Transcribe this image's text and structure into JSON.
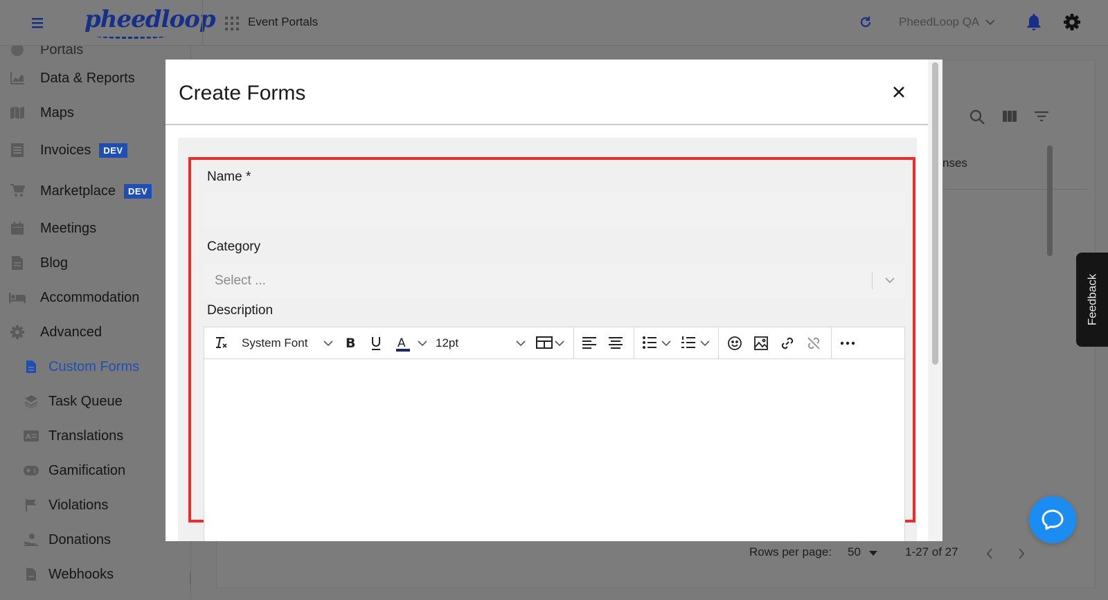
{
  "topbar": {
    "logo_text": "pheedloop",
    "portal_title": "Event Portals",
    "account_name": "PheedLoop QA"
  },
  "sidebar": {
    "partial_label": "Portals",
    "items": [
      {
        "label": "Data & Reports",
        "icon": "chart-icon"
      },
      {
        "label": "Maps",
        "icon": "map-icon"
      },
      {
        "label": "Invoices",
        "icon": "invoice-icon",
        "badge": "DEV"
      },
      {
        "label": "Marketplace",
        "icon": "cart-icon",
        "badge": "DEV"
      },
      {
        "label": "Meetings",
        "icon": "calendar-icon"
      },
      {
        "label": "Blog",
        "icon": "document-icon"
      },
      {
        "label": "Accommodation",
        "icon": "bed-icon"
      },
      {
        "label": "Advanced",
        "icon": "gear-icon"
      }
    ],
    "sub_items": [
      {
        "label": "Custom Forms",
        "icon": "form-icon",
        "active": true
      },
      {
        "label": "Task Queue",
        "icon": "layers-icon"
      },
      {
        "label": "Translations",
        "icon": "translate-icon"
      },
      {
        "label": "Gamification",
        "icon": "gamepad-icon"
      },
      {
        "label": "Violations",
        "icon": "flag-icon"
      },
      {
        "label": "Donations",
        "icon": "donation-icon"
      },
      {
        "label": "Webhooks",
        "icon": "webhook-icon"
      }
    ]
  },
  "background": {
    "column_partial": "nses",
    "rows_per_page_label": "Rows per page:",
    "rows_per_page_value": "50",
    "range_text": "1-27 of 27"
  },
  "modal": {
    "title": "Create Forms",
    "name_label": "Name *",
    "name_value": "",
    "category_label": "Category",
    "category_placeholder": "Select ...",
    "description_label": "Description",
    "editor": {
      "font_family": "System Font",
      "font_size": "12pt"
    }
  },
  "feedback_label": "Feedback",
  "colors": {
    "brand": "#16308a",
    "accent": "#1f4fb4",
    "highlight": "#ee2b2b",
    "chat": "#1b8cf2"
  }
}
